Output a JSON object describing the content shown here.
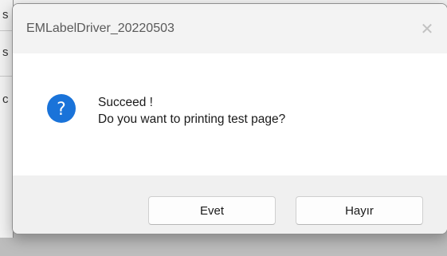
{
  "dialog": {
    "title": "EMLabelDriver_20220503",
    "close_glyph": "✕",
    "message_line1": "Succeed !",
    "message_line2": "Do you want to printing test page?",
    "icon": "question-icon",
    "icon_color": "#1a73d9",
    "buttons": {
      "yes_label": "Evet",
      "no_label": "Hayır"
    }
  },
  "background": {
    "fragments": [
      "s",
      "s",
      "c"
    ]
  }
}
